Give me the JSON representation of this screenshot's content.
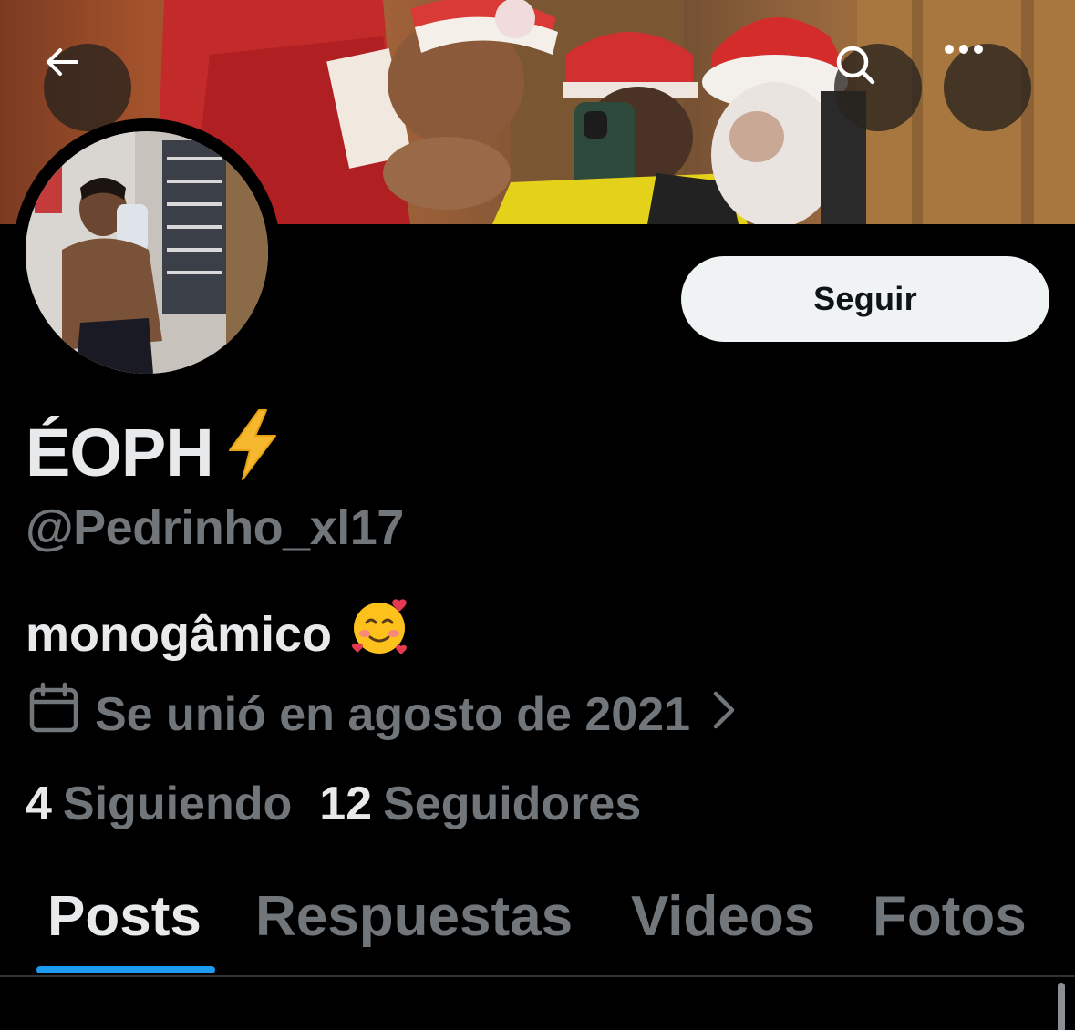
{
  "header": {
    "back_icon": "arrow-left-icon",
    "search_icon": "search-icon",
    "more_icon": "more-horizontal-icon"
  },
  "profile": {
    "display_name": "ÉOPH",
    "name_emoji": "⚡",
    "handle": "@Pedrinho_xl17",
    "bio": "monogâmico",
    "bio_emoji": "🥰",
    "joined": "Se unió en agosto de 2021",
    "follow_label": "Seguir"
  },
  "stats": {
    "following_count": "4",
    "following_label": "Siguiendo",
    "followers_count": "12",
    "followers_label": "Seguidores"
  },
  "tabs": [
    {
      "label": "Posts",
      "active": true
    },
    {
      "label": "Respuestas",
      "active": false
    },
    {
      "label": "Videos",
      "active": false
    },
    {
      "label": "Fotos",
      "active": false
    }
  ],
  "colors": {
    "background": "#000000",
    "primary_text": "#e7e9ea",
    "secondary_text": "#71767b",
    "accent": "#1d9bf0",
    "button_bg": "#eff3f4"
  }
}
